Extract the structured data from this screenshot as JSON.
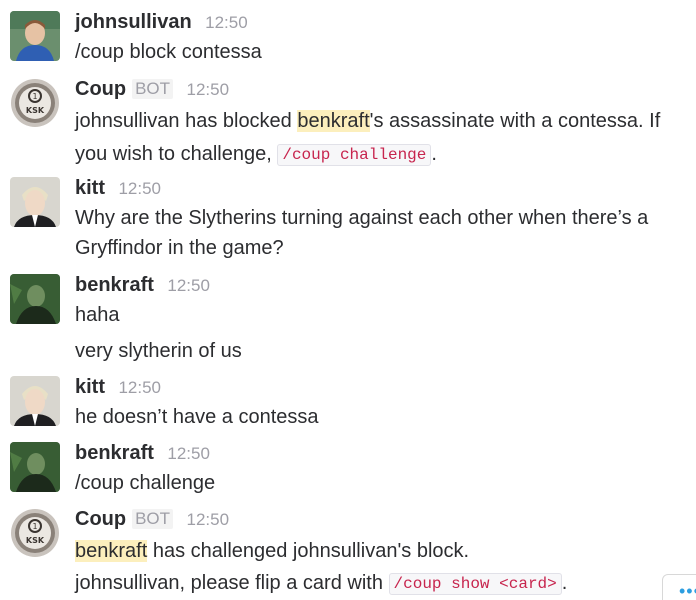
{
  "messages": [
    {
      "author": "johnsullivan",
      "time": "12:50",
      "lines": [
        "/coup block contessa"
      ]
    },
    {
      "author": "Coup",
      "badge": "BOT",
      "time": "12:50",
      "line1": {
        "pre": "johnsullivan has blocked ",
        "highlight": "benkraft",
        "post": "'s assassinate with a contessa.  If"
      },
      "line2": {
        "pre": "you wish to challenge, ",
        "code": "/coup challenge",
        "post": "."
      }
    },
    {
      "author": "kitt",
      "time": "12:50",
      "lines": [
        "Why are the Slytherins turning against each other when there’s a",
        "Gryffindor in the game?"
      ]
    },
    {
      "author": "benkraft",
      "time": "12:50",
      "lines": [
        "haha",
        "very slytherin of us"
      ]
    },
    {
      "author": "kitt",
      "time": "12:50",
      "lines": [
        "he doesn’t have a contessa"
      ]
    },
    {
      "author": "benkraft",
      "time": "12:50",
      "lines": [
        "/coup challenge"
      ]
    },
    {
      "author": "Coup",
      "badge": "BOT",
      "time": "12:50",
      "line1": {
        "highlight": "benkraft",
        "post": " has challenged johnsullivan's block."
      },
      "line2": {
        "pre": "johnsullivan, please flip a card with ",
        "code": "/coup show <card>",
        "post": "."
      }
    }
  ],
  "avatars": {
    "coup_label": "KSK"
  },
  "colors": {
    "mention_highlight": "#fcefbd",
    "code_text": "#c7254e",
    "more_dots": "#2d9ee0"
  },
  "more_button": {
    "icon": "ellipsis-icon",
    "label": "•••"
  }
}
